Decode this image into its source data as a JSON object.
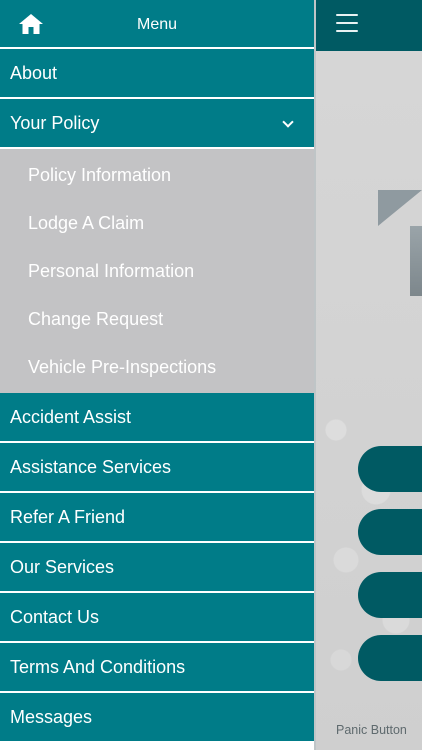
{
  "drawer": {
    "title": "Menu",
    "items_top": [
      {
        "label": "About"
      }
    ],
    "policy": {
      "label": "Your Policy",
      "subitems": [
        {
          "label": "Policy Information"
        },
        {
          "label": "Lodge A Claim"
        },
        {
          "label": "Personal Information"
        },
        {
          "label": "Change Request"
        },
        {
          "label": "Vehicle Pre-Inspections"
        }
      ]
    },
    "items_bottom": [
      {
        "label": "Accident Assist"
      },
      {
        "label": "Assistance Services"
      },
      {
        "label": "Refer A Friend"
      },
      {
        "label": "Our Services"
      },
      {
        "label": "Contact Us"
      },
      {
        "label": "Terms And Conditions"
      },
      {
        "label": "Messages"
      }
    ]
  },
  "main": {
    "panic_label": "Panic Button"
  },
  "icons": {
    "home": "home-icon",
    "menu": "hamburger-menu-icon",
    "chevron": "chevron-down-icon"
  },
  "colors": {
    "primary": "#007c88",
    "primary_dark": "#005a63",
    "submenu_bg": "#c3c3c5"
  }
}
